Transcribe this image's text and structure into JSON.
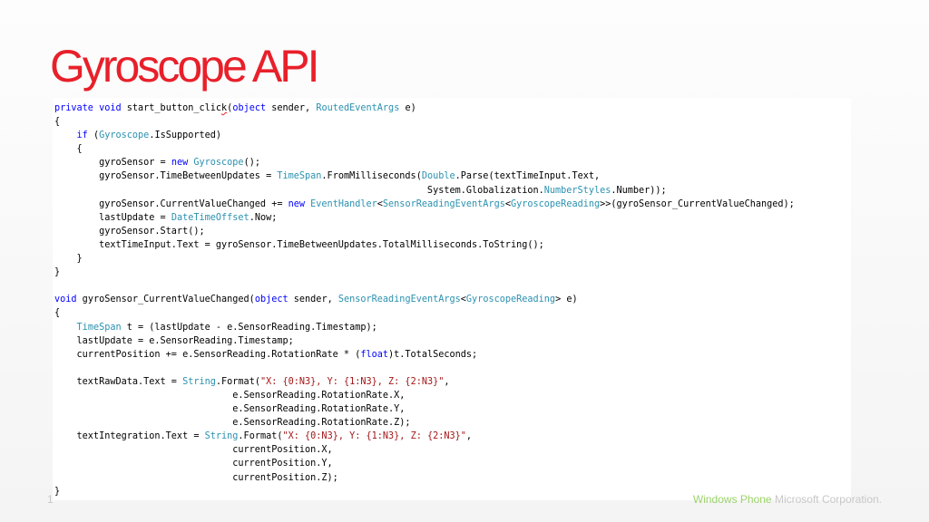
{
  "slide": {
    "title": "Gyroscope API",
    "slide_number": "1",
    "footer_brand": "Windows Phone",
    "footer_company": "Microsoft Corporation."
  },
  "code": {
    "lines": [
      [
        [
          "kw",
          "private"
        ],
        [
          "p",
          " "
        ],
        [
          "kw",
          "void"
        ],
        [
          "p",
          " start_button_clic"
        ],
        [
          "sq",
          "k"
        ],
        [
          "p",
          "("
        ],
        [
          "kw",
          "object"
        ],
        [
          "p",
          " sender, "
        ],
        [
          "ty",
          "RoutedEventArgs"
        ],
        [
          "p",
          " e)"
        ]
      ],
      [
        [
          "p",
          "{"
        ]
      ],
      [
        [
          "p",
          "    "
        ],
        [
          "kw",
          "if"
        ],
        [
          "p",
          " ("
        ],
        [
          "ty",
          "Gyroscope"
        ],
        [
          "p",
          ".IsSupported)"
        ]
      ],
      [
        [
          "p",
          "    {"
        ]
      ],
      [
        [
          "p",
          "        gyroSensor = "
        ],
        [
          "kw",
          "new"
        ],
        [
          "p",
          " "
        ],
        [
          "ty",
          "Gyroscope"
        ],
        [
          "p",
          "();"
        ]
      ],
      [
        [
          "p",
          "        gyroSensor.TimeBetweenUpdates = "
        ],
        [
          "ty",
          "TimeSpan"
        ],
        [
          "p",
          ".FromMilliseconds("
        ],
        [
          "ty",
          "Double"
        ],
        [
          "p",
          ".Parse(textTimeInput.Text,"
        ]
      ],
      [
        [
          "p",
          "                                                                   System.Globalization."
        ],
        [
          "ty",
          "NumberStyles"
        ],
        [
          "p",
          ".Number));"
        ]
      ],
      [
        [
          "p",
          "        gyroSensor.CurrentValueChanged += "
        ],
        [
          "kw",
          "new"
        ],
        [
          "p",
          " "
        ],
        [
          "ty",
          "EventHandler"
        ],
        [
          "p",
          "<"
        ],
        [
          "ty",
          "SensorReadingEventArgs"
        ],
        [
          "p",
          "<"
        ],
        [
          "ty",
          "GyroscopeReading"
        ],
        [
          "p",
          ">>(gyroSensor_CurrentValueChanged);"
        ]
      ],
      [
        [
          "p",
          "        lastUpdate = "
        ],
        [
          "ty",
          "DateTimeOffset"
        ],
        [
          "p",
          ".Now;"
        ]
      ],
      [
        [
          "p",
          "        gyroSensor.Start();"
        ]
      ],
      [
        [
          "p",
          "        textTimeInput.Text = gyroSensor.TimeBetweenUpdates.TotalMilliseconds.ToString();"
        ]
      ],
      [
        [
          "p",
          "    }"
        ]
      ],
      [
        [
          "p",
          "}"
        ]
      ],
      [
        [
          "p",
          ""
        ]
      ],
      [
        [
          "kw",
          "void"
        ],
        [
          "p",
          " gyroSensor_CurrentValueChanged("
        ],
        [
          "kw",
          "object"
        ],
        [
          "p",
          " sender, "
        ],
        [
          "ty",
          "SensorReadingEventArgs"
        ],
        [
          "p",
          "<"
        ],
        [
          "ty",
          "GyroscopeReading"
        ],
        [
          "p",
          "> e)"
        ]
      ],
      [
        [
          "p",
          "{"
        ]
      ],
      [
        [
          "p",
          "    "
        ],
        [
          "ty",
          "TimeSpan"
        ],
        [
          "p",
          " t = (lastUpdate - e.SensorReading.Timestamp);"
        ]
      ],
      [
        [
          "p",
          "    lastUpdate = e.SensorReading.Timestamp;"
        ]
      ],
      [
        [
          "p",
          "    currentPosition += e.SensorReading.RotationRate * ("
        ],
        [
          "kw",
          "float"
        ],
        [
          "p",
          ")t.TotalSeconds;"
        ]
      ],
      [
        [
          "p",
          ""
        ]
      ],
      [
        [
          "p",
          "    textRawData.Text = "
        ],
        [
          "ty",
          "String"
        ],
        [
          "p",
          ".Format("
        ],
        [
          "st",
          "\"X: {0:N3}, Y: {1:N3}, Z: {2:N3}\""
        ],
        [
          "p",
          ","
        ]
      ],
      [
        [
          "p",
          "                                e.SensorReading.RotationRate.X,"
        ]
      ],
      [
        [
          "p",
          "                                e.SensorReading.RotationRate.Y,"
        ]
      ],
      [
        [
          "p",
          "                                e.SensorReading.RotationRate.Z);"
        ]
      ],
      [
        [
          "p",
          "    textIntegration.Text = "
        ],
        [
          "ty",
          "String"
        ],
        [
          "p",
          ".Format("
        ],
        [
          "st",
          "\"X: {0:N3}, Y: {1:N3}, Z: {2:N3}\""
        ],
        [
          "p",
          ","
        ]
      ],
      [
        [
          "p",
          "                                currentPosition.X,"
        ]
      ],
      [
        [
          "p",
          "                                currentPosition.Y,"
        ]
      ],
      [
        [
          "p",
          "                                currentPosition.Z);"
        ]
      ],
      [
        [
          "p",
          "}"
        ]
      ]
    ],
    "colors": {
      "keyword": "#0000ff",
      "type": "#2b91af",
      "string": "#a31515",
      "plain": "#000000",
      "title": "#e8202a"
    }
  }
}
